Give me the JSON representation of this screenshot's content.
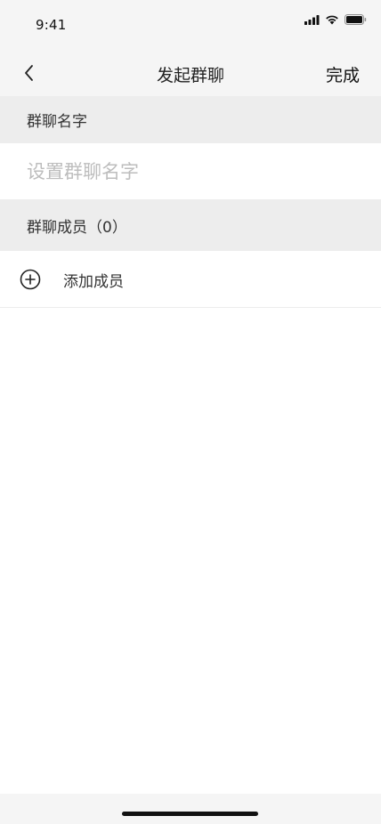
{
  "status_bar": {
    "time": "9:41",
    "icons": [
      "cellular-signal-icon",
      "wifi-icon",
      "battery-icon"
    ]
  },
  "nav": {
    "back_icon": "chevron-left-icon",
    "title": "发起群聊",
    "done_label": "完成"
  },
  "group_name": {
    "header": "群聊名字",
    "placeholder": "设置群聊名字",
    "value": ""
  },
  "members": {
    "header": "群聊成员（0）",
    "count": 0,
    "add_icon": "plus-circle-icon",
    "add_label": "添加成员"
  },
  "colors": {
    "bar_background": "#f5f5f5",
    "section_background": "#ededed",
    "placeholder_text": "#bdbdbd",
    "primary_text": "#333333"
  }
}
